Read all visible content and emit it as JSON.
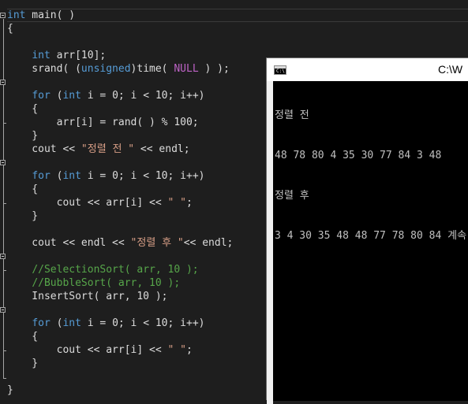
{
  "editor": {
    "lines": [
      [
        {
          "t": "int",
          "c": "kw"
        },
        {
          "t": " main( )"
        }
      ],
      [
        {
          "t": "{"
        }
      ],
      [],
      [
        {
          "t": "    "
        },
        {
          "t": "int",
          "c": "kw"
        },
        {
          "t": " arr[10];"
        }
      ],
      [
        {
          "t": "    srand( ("
        },
        {
          "t": "unsigned",
          "c": "kw"
        },
        {
          "t": ")time( "
        },
        {
          "t": "NULL",
          "c": "mac"
        },
        {
          "t": " ) );"
        }
      ],
      [],
      [
        {
          "t": "    "
        },
        {
          "t": "for",
          "c": "kw"
        },
        {
          "t": " ("
        },
        {
          "t": "int",
          "c": "kw"
        },
        {
          "t": " i = 0; i < 10; i++)"
        }
      ],
      [
        {
          "t": "    {"
        }
      ],
      [
        {
          "t": "        arr[i] = rand( ) % 100;"
        }
      ],
      [
        {
          "t": "    }"
        }
      ],
      [
        {
          "t": "    cout << "
        },
        {
          "t": "\"정렬 전 \"",
          "c": "str"
        },
        {
          "t": " << endl;"
        }
      ],
      [],
      [
        {
          "t": "    "
        },
        {
          "t": "for",
          "c": "kw"
        },
        {
          "t": " ("
        },
        {
          "t": "int",
          "c": "kw"
        },
        {
          "t": " i = 0; i < 10; i++)"
        }
      ],
      [
        {
          "t": "    {"
        }
      ],
      [
        {
          "t": "        cout << arr[i] << "
        },
        {
          "t": "\" \"",
          "c": "str"
        },
        {
          "t": ";"
        }
      ],
      [
        {
          "t": "    }"
        }
      ],
      [],
      [
        {
          "t": "    cout << endl << "
        },
        {
          "t": "\"정렬 후 \"",
          "c": "str"
        },
        {
          "t": "<< endl;"
        }
      ],
      [],
      [
        {
          "t": "    "
        },
        {
          "t": "//SelectionSort( arr, 10 );",
          "c": "cm"
        }
      ],
      [
        {
          "t": "    "
        },
        {
          "t": "//BubbleSort( arr, 10 );",
          "c": "cm"
        }
      ],
      [
        {
          "t": "    InsertSort( arr, 10 );"
        }
      ],
      [],
      [
        {
          "t": "    "
        },
        {
          "t": "for",
          "c": "kw"
        },
        {
          "t": " ("
        },
        {
          "t": "int",
          "c": "kw"
        },
        {
          "t": " i = 0; i < 10; i++)"
        }
      ],
      [
        {
          "t": "    {"
        }
      ],
      [
        {
          "t": "        cout << arr[i] << "
        },
        {
          "t": "\" \"",
          "c": "str"
        },
        {
          "t": ";"
        }
      ],
      [
        {
          "t": "    }"
        }
      ],
      [],
      [
        {
          "t": "}"
        }
      ]
    ]
  },
  "console": {
    "title": "C:\\W",
    "icon": "console-window-icon",
    "icon_text": "C:\\",
    "output": [
      "정렬 전",
      "48 78 80 4 35 30 77 84 3 48",
      "정렬 후",
      "3 4 30 35 48 48 77 78 80 84 계속"
    ]
  },
  "colors": {
    "keyword": "#569cd6",
    "string": "#d69d85",
    "comment": "#57a64a",
    "macro": "#bd63c5",
    "text": "#dcdcdc",
    "background": "#1e1e1e"
  }
}
